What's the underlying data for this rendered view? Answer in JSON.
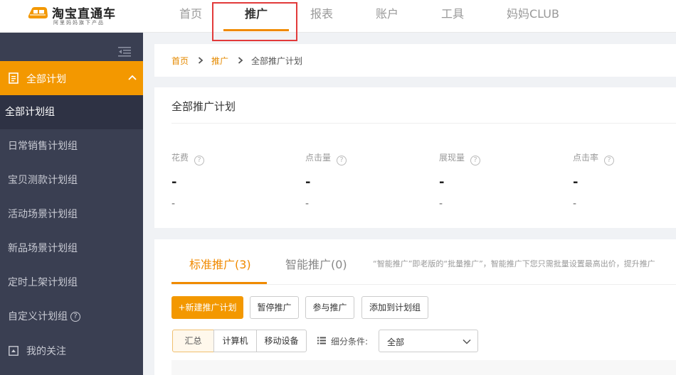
{
  "app": {
    "logo_title": "淘宝直通车",
    "logo_subtitle": "阿里妈妈旗下产品"
  },
  "nav": [
    {
      "label": "首页"
    },
    {
      "label": "推广"
    },
    {
      "label": "报表"
    },
    {
      "label": "账户"
    },
    {
      "label": "工具"
    },
    {
      "label": "妈妈CLUB"
    }
  ],
  "nav_active": "推广",
  "sidebar": {
    "section_title": "全部计划",
    "items": [
      {
        "label": "全部计划组"
      },
      {
        "label": "日常销售计划组"
      },
      {
        "label": "宝贝测款计划组"
      },
      {
        "label": "活动场景计划组"
      },
      {
        "label": "新品场景计划组"
      },
      {
        "label": "定时上架计划组"
      },
      {
        "label": "自定义计划组"
      }
    ],
    "help_glyph": "?",
    "attention_label": "我的关注"
  },
  "breadcrumb": {
    "home": "首页",
    "promo": "推广",
    "current": "全部推广计划"
  },
  "summary": {
    "title": "全部推广计划",
    "help_glyph": "?",
    "metrics": [
      {
        "label": "花费",
        "value": "-",
        "sub": "-"
      },
      {
        "label": "点击量",
        "value": "-",
        "sub": "-"
      },
      {
        "label": "展现量",
        "value": "-",
        "sub": "-"
      },
      {
        "label": "点击率",
        "value": "-",
        "sub": "-"
      }
    ]
  },
  "plans": {
    "tabs": [
      {
        "label": "标准推广(3)"
      },
      {
        "label": "智能推广(0)"
      }
    ],
    "note": "“智能推广”即老版的“批量推广”，智能推广下您只需批量设置最高出价，提升推广",
    "buttons": {
      "new_plan": "+新建推广计划",
      "pause": "暂停推广",
      "join": "参与推广",
      "add_group": "添加到计划组"
    },
    "segments": [
      {
        "label": "汇总"
      },
      {
        "label": "计算机"
      },
      {
        "label": "移动设备"
      }
    ],
    "filter_label": "细分条件:",
    "filter_value": "全部"
  },
  "colors": {
    "accent": "#f39800",
    "sidebar_bg": "#3a3f52",
    "highlight_box": "#e23a3a"
  }
}
